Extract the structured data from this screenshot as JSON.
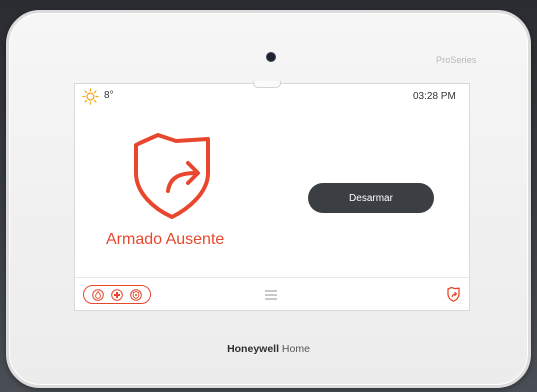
{
  "device": {
    "series_label": "ProSeries",
    "brand_bold": "Honeywell",
    "brand_light": "Home"
  },
  "status_bar": {
    "weather_icon": "sun-icon",
    "temperature": "8°",
    "time": "03:28 PM"
  },
  "arm_state": {
    "icon": "shield-arrow-icon",
    "label": "Armado Ausente",
    "color": "#e8472e"
  },
  "actions": {
    "disarm_label": "Desarmar",
    "button_color": "#3b3f44"
  },
  "bottom_bar": {
    "emergency_icons": [
      "fire-icon",
      "medical-icon",
      "police-icon"
    ],
    "menu_icon": "menu-icon",
    "status_icon": "arm-status-icon"
  },
  "colors": {
    "accent": "#e8472e",
    "sun": "#f5a623"
  }
}
